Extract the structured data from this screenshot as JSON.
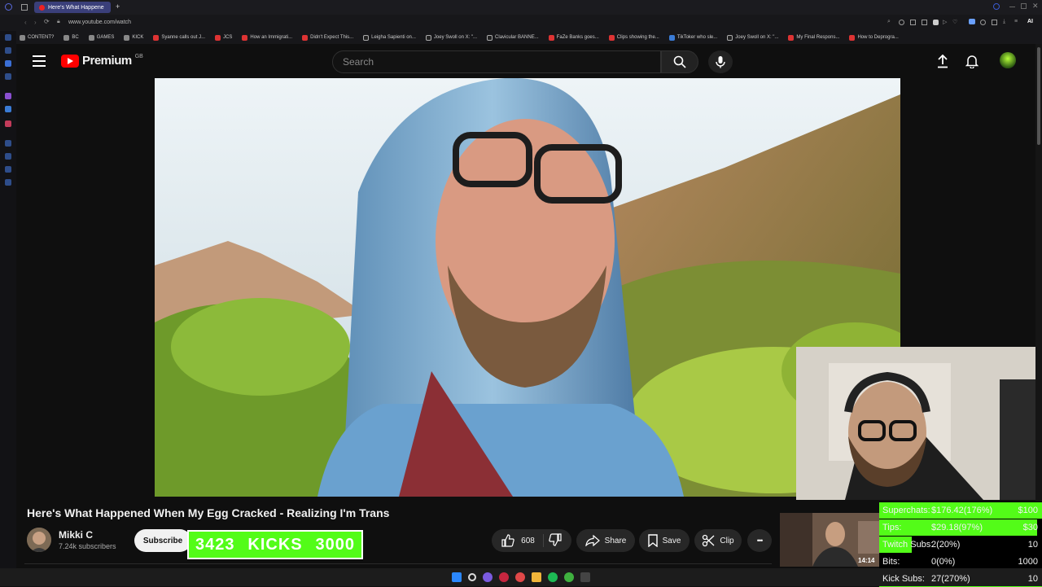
{
  "browser": {
    "active_tab_title": "Here's What Happene",
    "new_tab_glyph": "+",
    "url": "www.youtube.com/watch",
    "bookmarks": [
      "CONTENT?",
      "BC",
      "GAMES",
      "KICK",
      "Syanne calls out J...",
      "JCS",
      "How an Immigrati...",
      "Didn't Expect This...",
      "Leigha Sapienti on...",
      "Joey Swoll on X: \"...",
      "Clavicular BANNE...",
      "FaZe Banks goes...",
      "Clips showing the...",
      "TikToker who sle...",
      "Joey Swoll on X: \"...",
      "My Final Respons...",
      "How to Deprogra..."
    ],
    "ai_label": "AI"
  },
  "header": {
    "logo_text": "Premium",
    "region_badge": "GB",
    "search_placeholder": "Search"
  },
  "video": {
    "title": "Here's What Happened When My Egg Cracked - Realizing I'm Trans",
    "channel_name": "Mikki C",
    "subscribers": "7.24k subscribers",
    "subscribe_label": "Subscribe",
    "likes": "608",
    "share_label": "Share",
    "save_label": "Save",
    "clip_label": "Clip",
    "more_glyph": "•••"
  },
  "kicks_overlay": {
    "current": "3423",
    "label": "KICKS",
    "goal": "3000"
  },
  "pip": {
    "time": "14:14"
  },
  "stats": [
    {
      "label": "Superchats:",
      "value": "$176.42(176%)",
      "goal": "$100",
      "fill": 1.0
    },
    {
      "label": "Tips:",
      "value": "$29.18(97%)",
      "goal": "$30",
      "fill": 0.97
    },
    {
      "label": "Twitch Subs:",
      "value": "2(20%)",
      "goal": "10",
      "fill": 0.2
    },
    {
      "label": "Bits:",
      "value": "0(0%)",
      "goal": "1000",
      "fill": 0.0
    },
    {
      "label": "Kick Subs:",
      "value": "27(270%)",
      "goal": "10",
      "fill": 1.0
    }
  ],
  "colors": {
    "kick_green": "#53fc18",
    "youtube_red": "#ff0000",
    "page_bg": "#0f0f0f"
  }
}
